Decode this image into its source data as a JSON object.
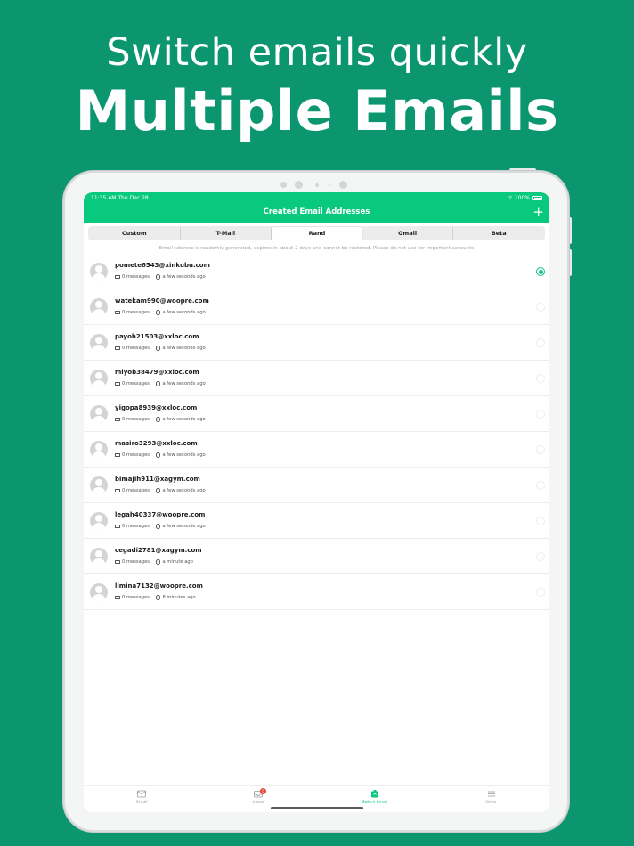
{
  "headline": {
    "line1": "Switch emails quickly",
    "line2": "Multiple Emails"
  },
  "status_bar": {
    "time": "11:35 AM  Thu Dec 28",
    "battery": "100%"
  },
  "nav": {
    "title": "Created Email Addresses",
    "add_label": "+"
  },
  "segments": [
    {
      "label": "Custom",
      "active": false
    },
    {
      "label": "T-Mail",
      "active": false
    },
    {
      "label": "Rand",
      "active": true
    },
    {
      "label": "Gmail",
      "active": false
    },
    {
      "label": "Beta",
      "active": false
    }
  ],
  "notice": "Email address is randomly generated, expires in about 2 days and cannot be restored. Please do not use for important accounts",
  "emails": [
    {
      "address": "pomete6543@xinkubu.com",
      "messages": "0 messages",
      "time": "a few seconds ago",
      "selected": true
    },
    {
      "address": "watekam990@woopre.com",
      "messages": "0 messages",
      "time": "a few seconds ago",
      "selected": false
    },
    {
      "address": "payoh21503@xxloc.com",
      "messages": "0 messages",
      "time": "a few seconds ago",
      "selected": false
    },
    {
      "address": "miyob38479@xxloc.com",
      "messages": "0 messages",
      "time": "a few seconds ago",
      "selected": false
    },
    {
      "address": "yigopa8939@xxloc.com",
      "messages": "0 messages",
      "time": "a few seconds ago",
      "selected": false
    },
    {
      "address": "masiro3293@xxloc.com",
      "messages": "0 messages",
      "time": "a few seconds ago",
      "selected": false
    },
    {
      "address": "bimajih911@xagym.com",
      "messages": "0 messages",
      "time": "a few seconds ago",
      "selected": false
    },
    {
      "address": "legah40337@woopre.com",
      "messages": "0 messages",
      "time": "a few seconds ago",
      "selected": false
    },
    {
      "address": "cegadi2781@xagym.com",
      "messages": "0 messages",
      "time": "a minute ago",
      "selected": false
    },
    {
      "address": "limina7132@woopre.com",
      "messages": "0 messages",
      "time": "8 minutes ago",
      "selected": false
    }
  ],
  "tabs": [
    {
      "label": "Email",
      "icon": "mail-icon",
      "active": false
    },
    {
      "label": "Inbox",
      "icon": "inbox-icon",
      "active": false,
      "badge": "0"
    },
    {
      "label": "Switch Email",
      "icon": "switch-email-icon",
      "active": true
    },
    {
      "label": "Other",
      "icon": "menu-icon",
      "active": false
    }
  ],
  "colors": {
    "background": "#0b9670",
    "accent": "#09c97e",
    "badge": "#e8463a"
  }
}
